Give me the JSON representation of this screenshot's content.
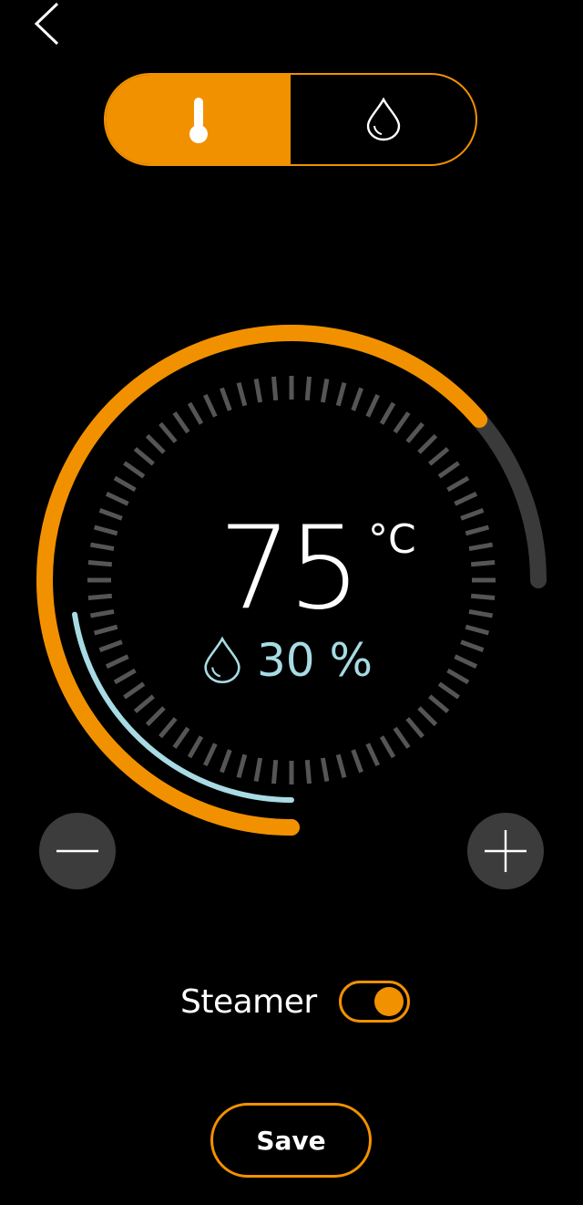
{
  "header": {
    "back_icon": "chevron-left-icon"
  },
  "mode_switch": {
    "selected": "temperature",
    "options": [
      {
        "id": "temperature",
        "icon": "thermometer-icon"
      },
      {
        "id": "humidity",
        "icon": "water-drop-icon"
      }
    ]
  },
  "dial": {
    "temperature_value": "75",
    "temperature_unit": "°C",
    "humidity_value": "30 %",
    "humidity_icon": "water-drop-icon",
    "temperature_arc_fraction": 0.85,
    "humidity_arc_fraction": 0.3
  },
  "controls": {
    "decrease_icon": "minus-icon",
    "increase_icon": "plus-icon"
  },
  "steamer": {
    "label": "Steamer",
    "enabled": true
  },
  "save_label": "Save",
  "colors": {
    "accent": "#f29100",
    "humidity": "#a8dbe4",
    "track": "#3a3a3a",
    "ticks": "#555555",
    "background": "#000000"
  }
}
